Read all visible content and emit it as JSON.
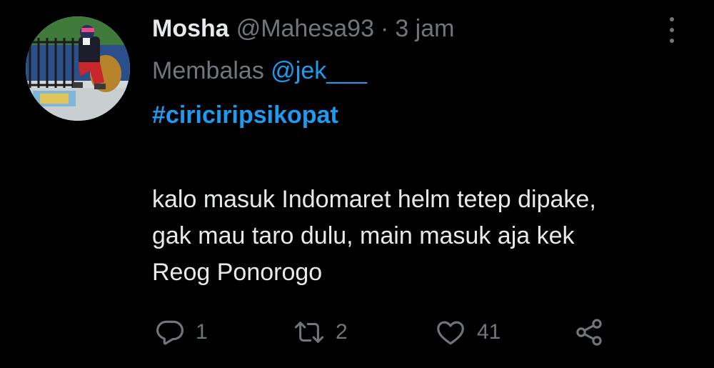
{
  "tweet": {
    "author_name": "Mosha",
    "author_handle": "@Mahesa93",
    "separator": "·",
    "time": "3 jam",
    "reply_prefix": "Membalas",
    "reply_to": "@jek___",
    "hashtag": "#ciriciripsikopat",
    "body_lines": [
      "kalo masuk Indomaret helm tetep dipake,",
      "gak mau taro dulu, main masuk aja kek",
      "Reog Ponorogo"
    ],
    "actions": {
      "reply_count": "1",
      "retweet_count": "2",
      "like_count": "41"
    }
  },
  "icons": {
    "more": "more-vertical-icon",
    "reply": "reply-bubble-icon",
    "retweet": "retweet-icon",
    "like": "heart-icon",
    "share": "share-icon"
  },
  "colors": {
    "background": "#000000",
    "text_primary": "#e7e9ea",
    "text_secondary": "#71767b",
    "link": "#1d9bf0"
  }
}
